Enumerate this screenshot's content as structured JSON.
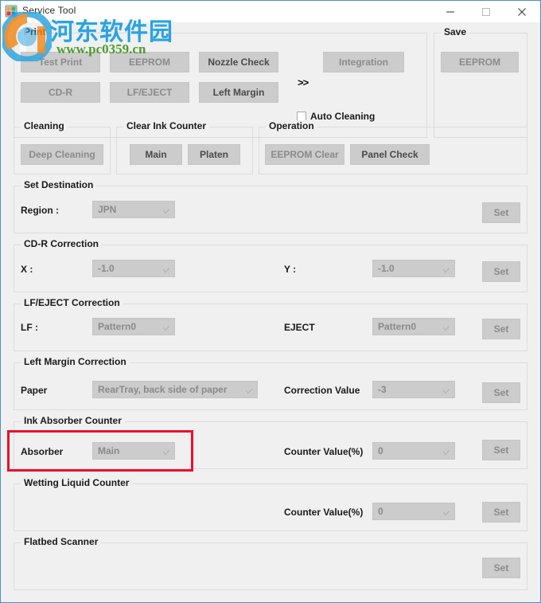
{
  "window": {
    "title": "Service Tool",
    "icon": "app-icon",
    "controls": {
      "minimize": "minimize-icon",
      "maximize": "maximize-icon",
      "close": "close-icon"
    },
    "border_color": "#4a91c4",
    "client_bg": "#f0f0f0"
  },
  "watermark": {
    "chinese": "河东软件园",
    "url": "www.pc0359.cn",
    "chinese_color": "#2aa3e0",
    "url_color": "#4c9c2e"
  },
  "annotation": {
    "highlight_color": "#e8112d",
    "target": "absorber-row"
  },
  "groups": {
    "print": {
      "legend": "Print",
      "buttons": [
        {
          "label": "Test Print",
          "enabled": false
        },
        {
          "label": "EEPROM",
          "enabled": false
        },
        {
          "label": "Nozzle Check",
          "enabled": true
        },
        {
          "label": "Integration",
          "enabled": false
        },
        {
          "label": "CD-R",
          "enabled": false
        },
        {
          "label": "LF/EJECT",
          "enabled": false
        },
        {
          "label": "Left Margin",
          "enabled": true
        }
      ],
      "separator": ">>",
      "checkbox": {
        "label": "Auto Cleaning",
        "checked": false
      }
    },
    "save": {
      "legend": "Save",
      "buttons": [
        {
          "label": "EEPROM",
          "enabled": false
        }
      ]
    },
    "cleaning": {
      "legend": "Cleaning",
      "buttons": [
        {
          "label": "Deep Cleaning",
          "enabled": false
        }
      ]
    },
    "clear_ink_counter": {
      "legend": "Clear Ink Counter",
      "buttons": [
        {
          "label": "Main",
          "enabled": true
        },
        {
          "label": "Platen",
          "enabled": true
        }
      ]
    },
    "operation": {
      "legend": "Operation",
      "buttons": [
        {
          "label": "EEPROM Clear",
          "enabled": false
        },
        {
          "label": "Panel Check",
          "enabled": true
        }
      ]
    },
    "set_destination": {
      "legend": "Set Destination",
      "region_label": "Region :",
      "region_value": "JPN",
      "set_label": "Set"
    },
    "cdr_correction": {
      "legend": "CD-R Correction",
      "x_label": "X :",
      "x_value": "-1.0",
      "y_label": "Y :",
      "y_value": "-1.0",
      "set_label": "Set"
    },
    "lf_eject_correction": {
      "legend": "LF/EJECT Correction",
      "lf_label": "LF :",
      "lf_value": "Pattern0",
      "eject_label": "EJECT",
      "eject_value": "Pattern0",
      "set_label": "Set"
    },
    "left_margin_correction": {
      "legend": "Left Margin Correction",
      "paper_label": "Paper",
      "paper_value": "RearTray, back side of paper",
      "correction_label": "Correction Value",
      "correction_value": "-3",
      "set_label": "Set"
    },
    "ink_absorber_counter": {
      "legend": "Ink Absorber Counter",
      "absorber_label": "Absorber",
      "absorber_value": "Main",
      "counter_label": "Counter Value(%)",
      "counter_value": "0",
      "set_label": "Set"
    },
    "wetting_liquid_counter": {
      "legend": "Wetting Liquid Counter",
      "counter_label": "Counter Value(%)",
      "counter_value": "0",
      "set_label": "Set"
    },
    "flatbed_scanner": {
      "legend": "Flatbed Scanner",
      "set_label": "Set"
    }
  }
}
